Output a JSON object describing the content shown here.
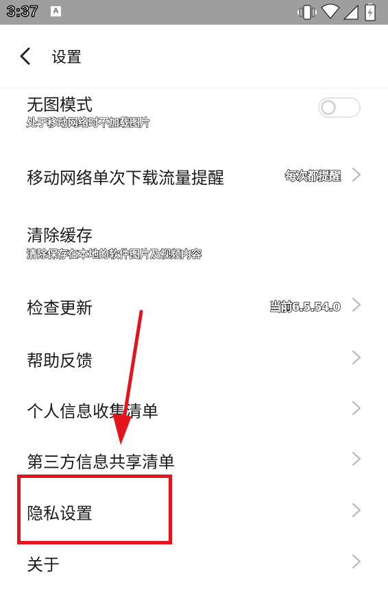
{
  "status_bar": {
    "time": "3:37",
    "notif_icon": "A",
    "icons": [
      "vibrate-icon",
      "wifi-icon",
      "signal-icon",
      "battery-charging-icon"
    ]
  },
  "header": {
    "title": "设置",
    "back_icon": "chevron-left-icon"
  },
  "settings": [
    {
      "title": "无图模式",
      "subtitle": "处于移动网络时不加载图片",
      "control": "toggle",
      "toggle_on": false
    },
    {
      "title": "移动网络单次下载流量提醒",
      "value": "每次都提醒",
      "control": "chevron"
    },
    {
      "title": "清除缓存",
      "subtitle": "清除保存在本地的软件图片及视频内容",
      "control": "none"
    },
    {
      "title": "检查更新",
      "value": "当前6.5.54.0",
      "control": "chevron"
    },
    {
      "title": "帮助反馈",
      "control": "chevron"
    },
    {
      "title": "个人信息收集清单",
      "control": "chevron"
    },
    {
      "title": "第三方信息共享清单",
      "control": "chevron"
    },
    {
      "title": "隐私设置",
      "control": "chevron",
      "highlighted": true
    },
    {
      "title": "关于",
      "control": "chevron"
    }
  ],
  "colors": {
    "status_bar": "#9e9e9e",
    "annotation": "#e3141b",
    "chevron": "#bdbdbd",
    "toggle_border": "#e4e4e4"
  }
}
